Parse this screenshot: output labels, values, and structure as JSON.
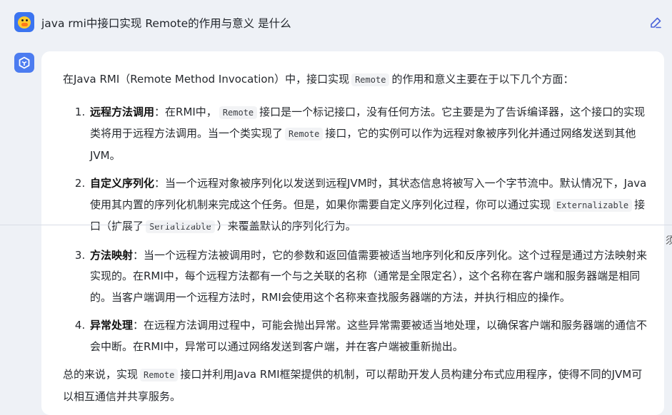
{
  "user": {
    "question": "java rmi中接口实现 Remote的作用与意义 是什么"
  },
  "answer": {
    "intro": {
      "pre": "在Java RMI（Remote Method Invocation）中，接口实现",
      "code": "Remote",
      "post": "的作用和意义主要在于以下几个方面："
    },
    "items": [
      {
        "title": "远程方法调用",
        "t1": "：在RMI中，",
        "c1": "Remote",
        "t2": "接口是一个标记接口，没有任何方法。它主要是为了告诉编译器，这个接口的实现类将用于远程方法调用。当一个类实现了",
        "c2": "Remote",
        "t3": "接口，它的实例可以作为远程对象被序列化并通过网络发送到其他JVM。"
      },
      {
        "title": "自定义序列化",
        "t1": "：当一个远程对象被序列化以发送到远程JVM时，其状态信息将被写入一个字节流中。默认情况下，Java使用其内置的序列化机制来完成这个任务。但是，如果你需要自定义序列化过程，你可以通过实现",
        "c1": "Externalizable",
        "t2": "接口（扩展了",
        "c2": "Serializable",
        "t3": "）来覆盖默认的序列化行为。"
      },
      {
        "title": "方法映射",
        "t1": "：当一个远程方法被调用时，它的参数和返回值需要被适当地序列化和反序列化。这个过程是通过方法映射来实现的。在RMI中，每个远程方法都有一个与之关联的名称（通常是全限定名），这个名称在客户端和服务器端是相同的。当客户端调用一个远程方法时，RMI会使用这个名称来查找服务器端的方法，并执行相应的操作。"
      },
      {
        "title": "异常处理",
        "t1": "：在远程方法调用过程中，可能会抛出异常。这些异常需要被适当地处理，以确保客户端和服务器端的通信不会中断。在RMI中，异常可以通过网络发送到客户端，并在客户端被重新抛出。"
      }
    ],
    "summary": {
      "pre": "总的来说，实现",
      "code": "Remote",
      "post": "接口并利用Java RMI框架提供的机制，可以帮助开发人员构建分布式应用程序，使得不同的JVM可以相互通信并共享服务。"
    }
  },
  "edge_fragment": "须"
}
